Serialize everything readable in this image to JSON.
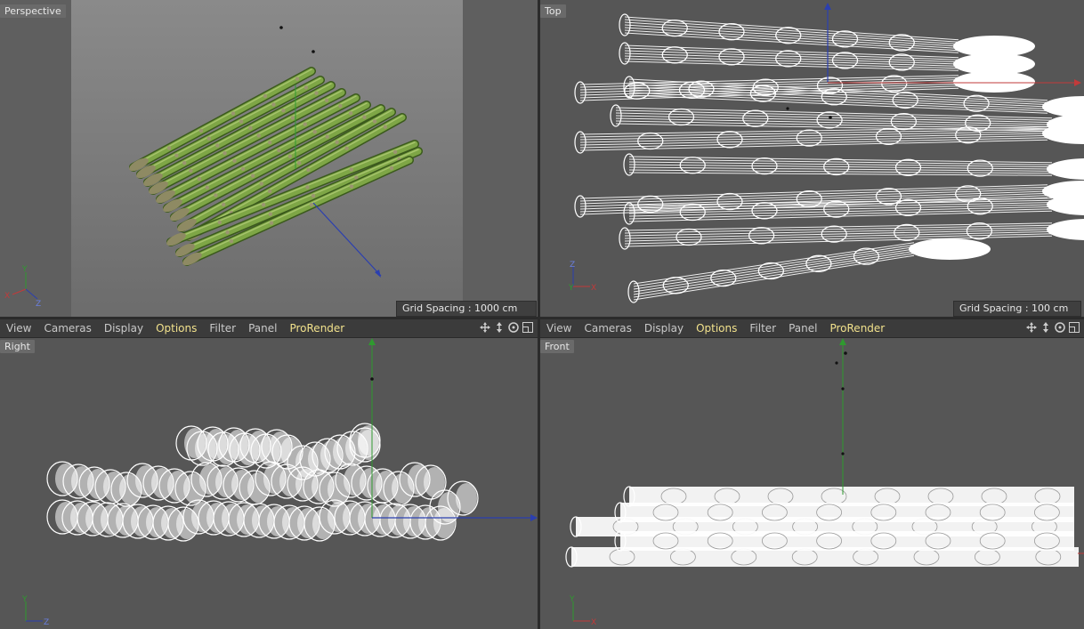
{
  "viewports": {
    "perspective": {
      "label": "Perspective",
      "grid": "Grid Spacing : 1000 cm",
      "gizmo": {
        "a": "Y",
        "b": "X",
        "c": "Z"
      }
    },
    "top": {
      "label": "Top",
      "grid": "Grid Spacing : 100 cm",
      "gizmo": {
        "a": "Z",
        "b": "Y",
        "c": "X"
      }
    },
    "right": {
      "label": "Right",
      "gizmo": {
        "a": "Y",
        "b": "Z"
      }
    },
    "front": {
      "label": "Front",
      "gizmo": {
        "a": "Y",
        "b": "X"
      }
    }
  },
  "menu_left": {
    "view": "View",
    "cameras": "Cameras",
    "display": "Display",
    "options": "Options",
    "filter": "Filter",
    "panel": "Panel",
    "prorender": "ProRender"
  },
  "menu_right": {
    "view": "View",
    "cameras": "Cameras",
    "display": "Display",
    "options": "Options",
    "filter": "Filter",
    "panel": "Panel",
    "prorender": "ProRender"
  },
  "colors": {
    "axis_x": "#c23a3a",
    "axis_y": "#2f9a2f",
    "axis_z": "#2b3fb0",
    "highlight": "#f1e18c",
    "viewport_bg": "#565656"
  },
  "icons": [
    "move-icon",
    "scale-icon",
    "rotate-icon",
    "maximize-icon"
  ]
}
